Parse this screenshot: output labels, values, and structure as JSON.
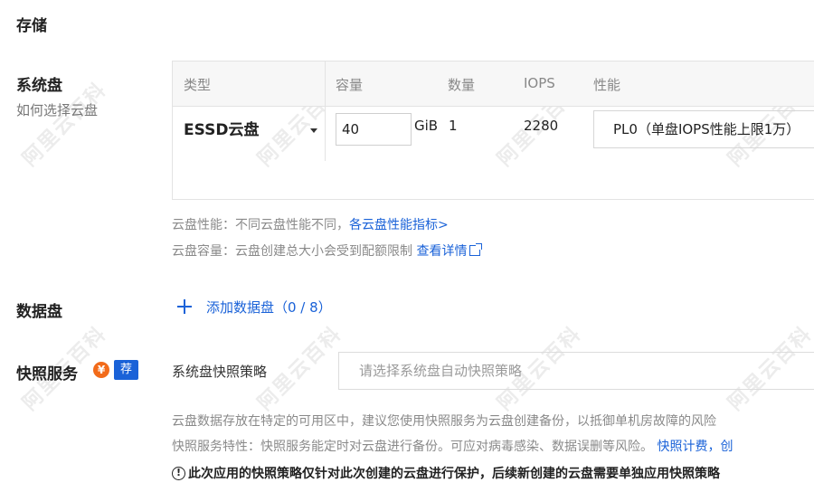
{
  "header": {
    "title": "存储"
  },
  "system_disk": {
    "title": "系统盘",
    "help_link": "如何选择云盘",
    "table": {
      "headers": [
        "类型",
        "容量",
        "数量",
        "IOPS",
        "性能"
      ],
      "type": "ESSD云盘",
      "capacity": "40",
      "unit": "GiB",
      "quantity": "1",
      "iops": "2280",
      "performance": "PL0（单盘IOPS性能上限1万）"
    },
    "perf_note_label": "云盘性能：不同云盘性能不同，",
    "perf_note_link": "各云盘性能指标>",
    "cap_note_label": "云盘容量：云盘创建总大小会受到配额限制",
    "cap_note_link": "查看详情"
  },
  "data_disk": {
    "title": "数据盘",
    "add_label": "添加数据盘（0 / 8）"
  },
  "snapshot": {
    "title": "快照服务",
    "yuan_badge": "¥",
    "rec_badge": "荐",
    "policy_label": "系统盘快照策略",
    "policy_placeholder": "请选择系统盘自动快照策略",
    "desc1": "云盘数据存放在特定的可用区中，建议您使用快照服务为云盘创建备份，以抵御单机房故障的风险",
    "desc2": "快照服务特性：快照服务能定时对云盘进行备份。可应对病毒感染、数据误删等风险。",
    "desc2_link": "快照计费，",
    "desc2_link_tail": "创",
    "warning_icon": "!",
    "warning": "此次应用的快照策略仅针对此次创建的云盘进行保护，后续新创建的云盘需要单独应用快照策略"
  },
  "watermark": "阿里云百科"
}
